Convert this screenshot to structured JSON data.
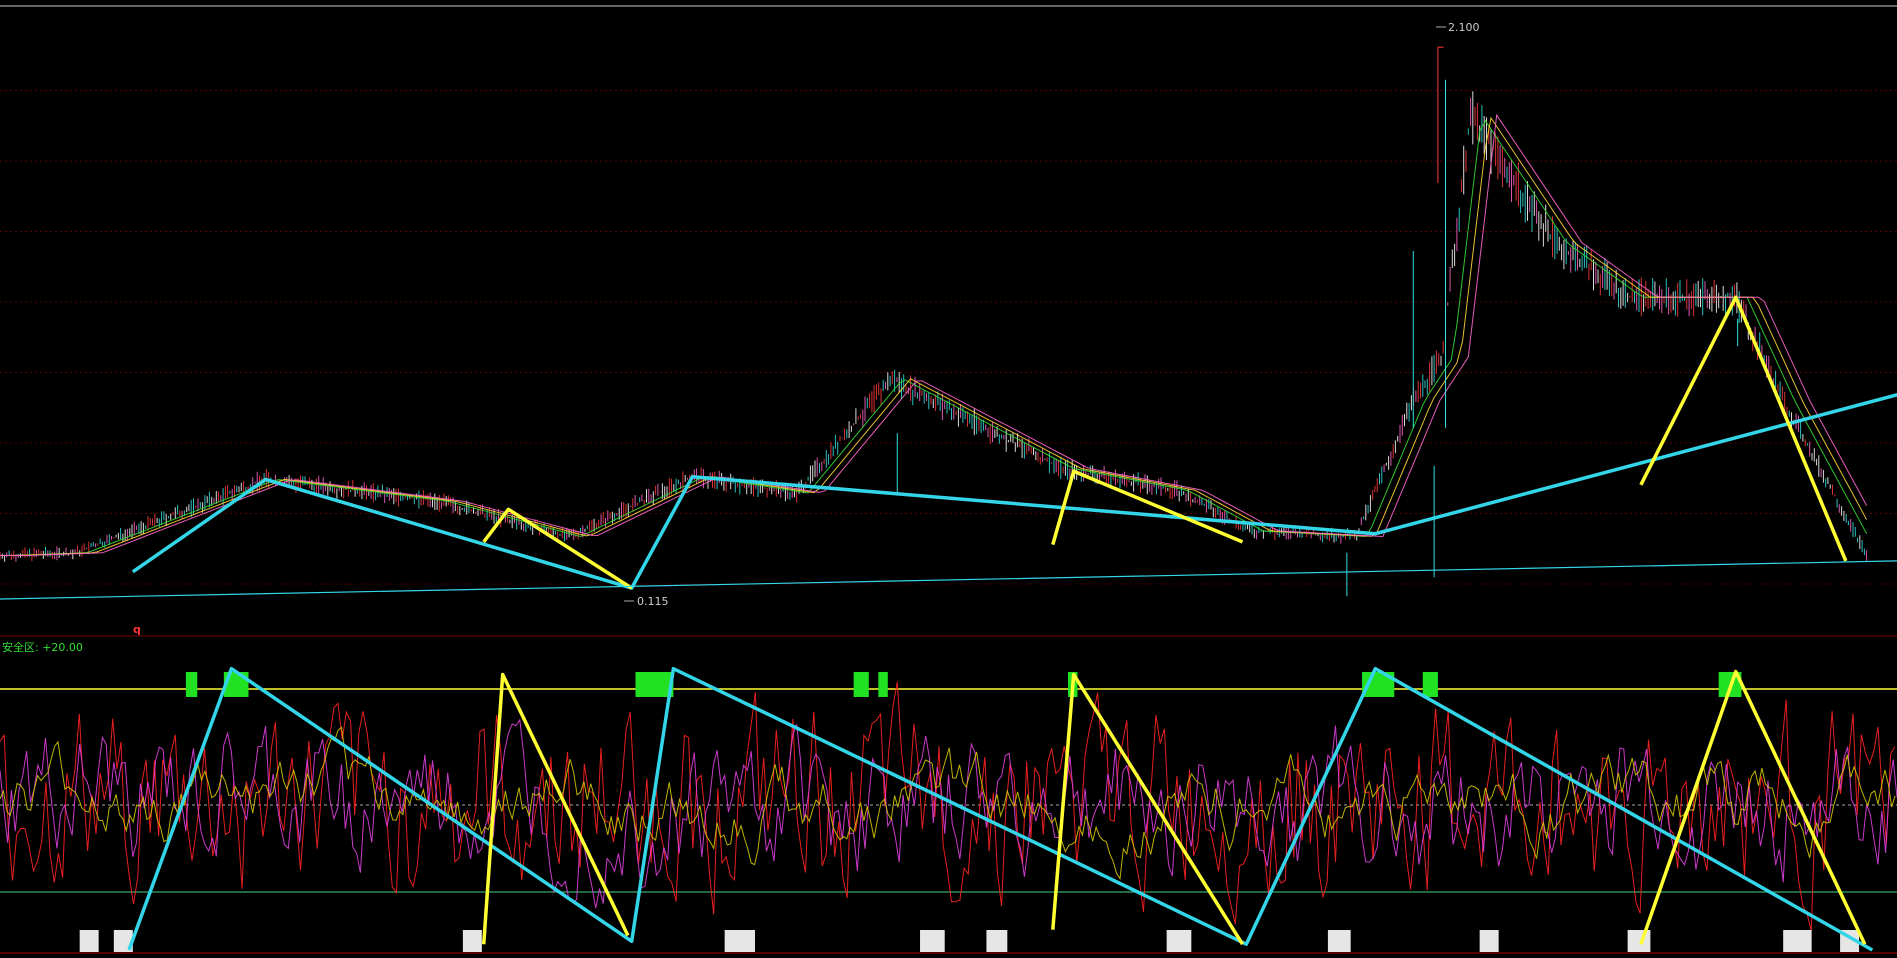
{
  "chart_data": [
    {
      "type": "line",
      "panel": "price",
      "annotations": {
        "high_label": "2.100",
        "low_label": "0.115",
        "marker_label": "q"
      },
      "x_range": [
        0,
        1000
      ],
      "ylim": [
        0,
        2.2
      ],
      "grid": true,
      "series": [
        {
          "role": "zigzag-major",
          "color": "#33d6e8",
          "x": [
            70,
            140,
            333,
            365,
            725,
            1010,
            1128
          ],
          "y": [
            0.17,
            0.51,
            0.11,
            0.52,
            0.31,
            0.84,
            0.25
          ]
        },
        {
          "role": "zigzag-minor",
          "color": "#ffff33",
          "x": [
            255,
            268,
            333
          ],
          "y": [
            0.28,
            0.4,
            0.11
          ]
        },
        {
          "role": "zigzag-minor",
          "color": "#ffff33",
          "x": [
            555,
            566,
            655
          ],
          "y": [
            0.27,
            0.54,
            0.28
          ]
        },
        {
          "role": "zigzag-minor",
          "color": "#ffff33",
          "x": [
            865,
            915,
            973
          ],
          "y": [
            0.49,
            1.18,
            0.21
          ]
        },
        {
          "role": "trend-line",
          "color": "#33d6e8",
          "x": [
            0,
            1000
          ],
          "y": [
            0.07,
            0.21
          ]
        }
      ]
    },
    {
      "type": "line",
      "panel": "oscillator",
      "legend_text": "安全区: +20.00",
      "x_range": [
        0,
        1000
      ],
      "ylim": [
        0,
        100
      ],
      "reference_levels": [
        {
          "value": 90,
          "color": "#ffff33",
          "style": "solid"
        },
        {
          "value": 50,
          "color": "#aaaaaa",
          "style": "dashed"
        },
        {
          "value": 20,
          "color": "#2e8b57",
          "style": "solid"
        }
      ],
      "series": [
        {
          "role": "zigzag-major",
          "color": "#33d6e8",
          "x": [
            68,
            122,
            333,
            355,
            657,
            725,
            987
          ],
          "y": [
            0,
            97,
            3,
            97,
            2,
            97,
            0
          ]
        },
        {
          "role": "zigzag-minor",
          "color": "#ffff33",
          "x": [
            255,
            265,
            331
          ],
          "y": [
            2,
            95,
            5
          ]
        },
        {
          "role": "zigzag-minor",
          "color": "#ffff33",
          "x": [
            555,
            566,
            655
          ],
          "y": [
            7,
            95,
            2
          ]
        },
        {
          "role": "zigzag-minor",
          "color": "#ffff33",
          "x": [
            865,
            915,
            983
          ],
          "y": [
            2,
            96,
            2
          ]
        }
      ]
    }
  ]
}
